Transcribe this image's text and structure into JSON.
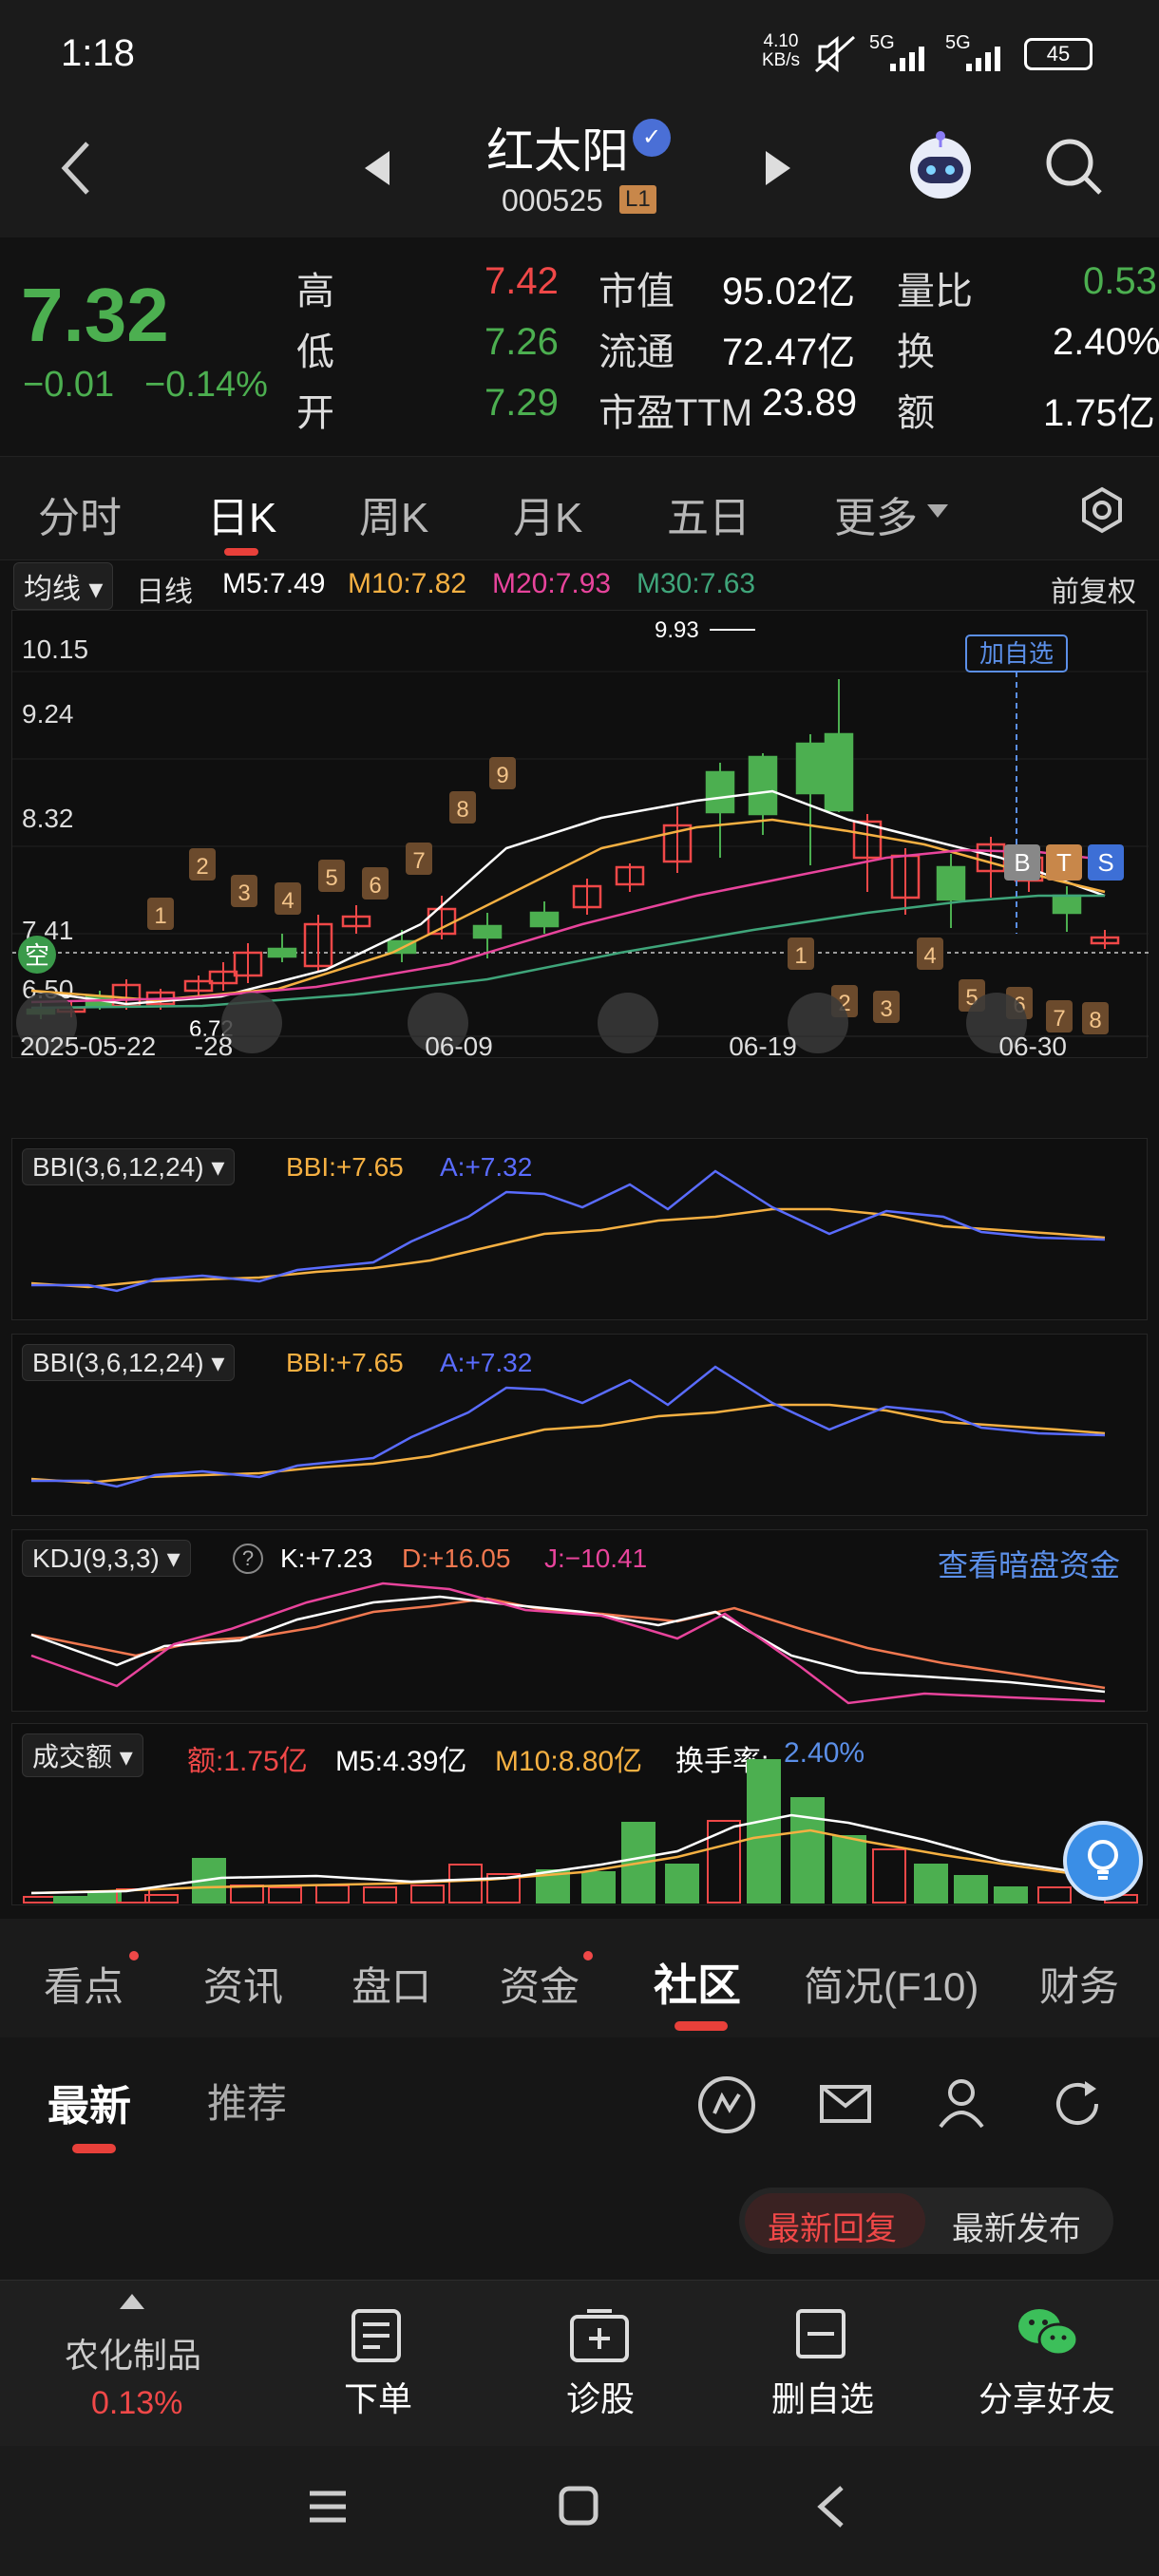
{
  "status": {
    "time": "1:18",
    "net_speed": "4.10\nKB/s",
    "net_speed_top": "4.10",
    "net_speed_bottom": "KB/s",
    "sig1": "5G",
    "sig2": "5G",
    "battery": "45"
  },
  "header": {
    "name": "红太阳",
    "code": "000525",
    "level_badge": "L1"
  },
  "quote": {
    "price": "7.32",
    "change": "−0.01",
    "change_pct": "−0.14%",
    "rows": [
      {
        "l1": "高",
        "v1": "7.42",
        "l2": "市值",
        "v2": "95.02亿",
        "l3": "量比",
        "v3": "0.53"
      },
      {
        "l1": "低",
        "v1": "7.26",
        "l2": "流通",
        "v2": "72.47亿",
        "l3": "换",
        "v3": "2.40%"
      },
      {
        "l1": "开",
        "v1": "7.29",
        "l2": "市盈TTM",
        "v2": "23.89",
        "l3": "额",
        "v3": "1.75亿"
      }
    ],
    "colors": {
      "up": "#f04848",
      "down": "#4caf50"
    }
  },
  "tabs": {
    "items": [
      "分时",
      "日K",
      "周K",
      "月K",
      "五日",
      "更多"
    ],
    "active": "日K"
  },
  "ma": {
    "selector": "均线",
    "period": "日线",
    "m5": "M5:7.49",
    "m10": "M10:7.82",
    "m20": "M20:7.93",
    "m30": "M30:7.63",
    "adjust": "前复权"
  },
  "kchart": {
    "ticks": [
      "10.15",
      "9.24",
      "8.32",
      "7.41",
      "6.50"
    ],
    "dates": [
      "2025-05-22",
      "-28",
      "06-09",
      "06-19",
      "06-30"
    ],
    "high_mark": "9.93",
    "low_mark": "6.72",
    "add_watch": "加自选",
    "side_label": "空",
    "bts": [
      "B",
      "T",
      "S"
    ],
    "candle_nums": [
      "1",
      "2",
      "3",
      "4",
      "5",
      "6",
      "7",
      "8",
      "9",
      "1",
      "2",
      "3",
      "4",
      "5",
      "6",
      "7",
      "8"
    ]
  },
  "bbi1": {
    "selector": "BBI(3,6,12,24)",
    "bbi": "BBI:+7.65",
    "a": "A:+7.32"
  },
  "bbi2": {
    "selector": "BBI(3,6,12,24)",
    "bbi": "BBI:+7.65",
    "a": "A:+7.32"
  },
  "kdj": {
    "selector": "KDJ(9,3,3)",
    "help": "?",
    "k": "K:+7.23",
    "d": "D:+16.05",
    "j": "J:−10.41",
    "link": "查看暗盘资金"
  },
  "volume": {
    "selector": "成交额",
    "amount": "额:1.75亿",
    "m5": "M5:4.39亿",
    "m10": "M10:8.80亿",
    "turnover_label": "换手率:",
    "turnover": "2.40%"
  },
  "bottom_tabs": {
    "items": [
      "看点",
      "资讯",
      "盘口",
      "资金",
      "社区",
      "简况(F10)",
      "财务"
    ],
    "active": "社区"
  },
  "community": {
    "tabs": [
      "最新",
      "推荐"
    ],
    "active": "最新",
    "sort": [
      "最新回复",
      "最新发布"
    ],
    "sort_active": "最新回复"
  },
  "actions": {
    "sector": "农化制品",
    "sector_pct": "0.13%",
    "order": "下单",
    "diagnose": "诊股",
    "remove": "删自选",
    "share": "分享好友"
  }
}
